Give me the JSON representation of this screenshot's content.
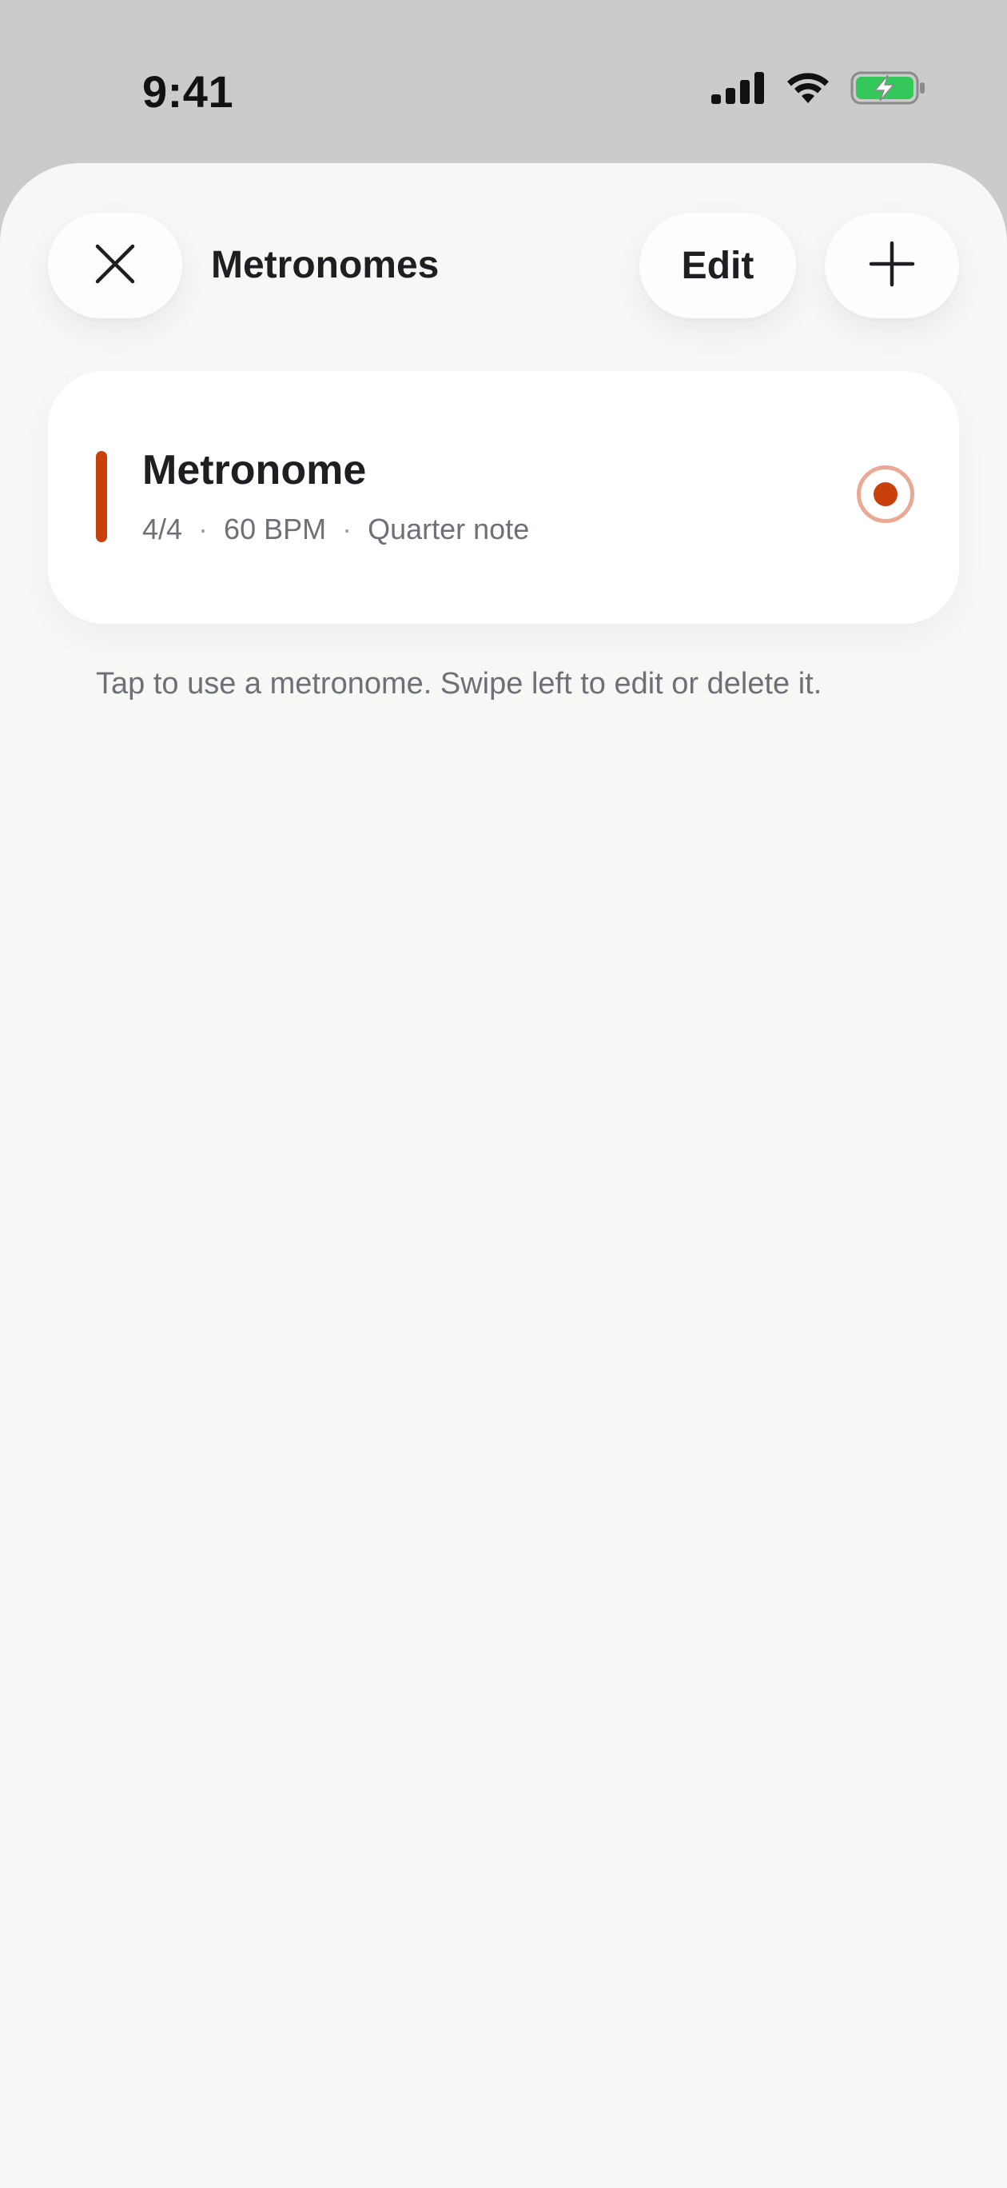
{
  "status_bar": {
    "time": "9:41",
    "icons": [
      "cellular-signal-icon",
      "wifi-icon",
      "battery-charging-icon"
    ]
  },
  "header": {
    "title": "Metronomes",
    "close_icon": "close-icon",
    "edit_label": "Edit",
    "add_icon": "plus-icon"
  },
  "metronomes": [
    {
      "name": "Metronome",
      "time_signature": "4/4",
      "tempo": "60 BPM",
      "subdivision": "Quarter note",
      "selected": true
    }
  ],
  "hint": "Tap to use a metronome. Swipe left to edit or delete it.",
  "colors": {
    "accent": "#c9400c",
    "radio_ring": "#eaa995",
    "battery_fill": "#34c759",
    "sheet_background": "#f7f7f6",
    "backdrop": "#cbcbcb"
  }
}
